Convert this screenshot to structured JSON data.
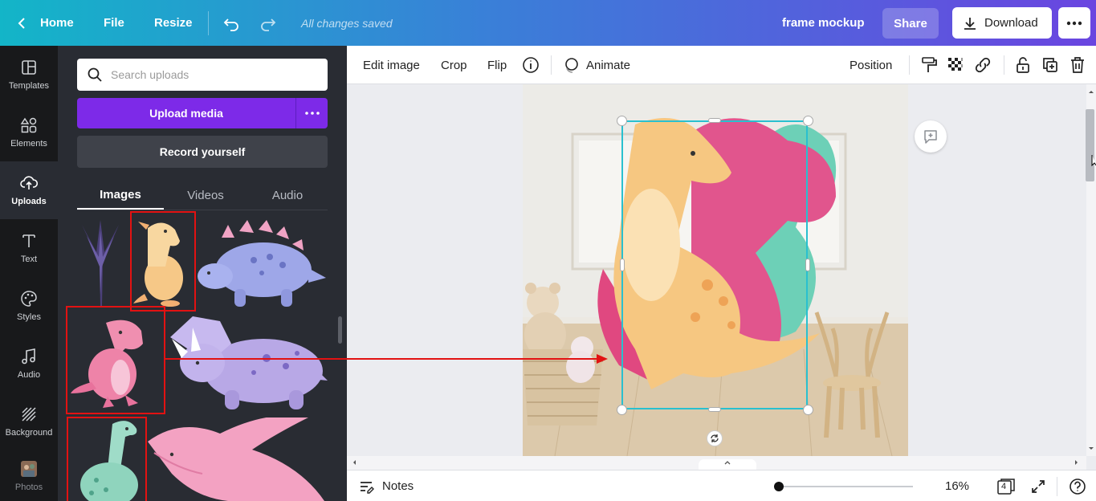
{
  "topbar": {
    "home": "Home",
    "file": "File",
    "resize": "Resize",
    "status": "All changes saved",
    "design_title": "frame mockup",
    "share": "Share",
    "download": "Download"
  },
  "rail": {
    "items": [
      {
        "label": "Templates",
        "icon": "templates-icon"
      },
      {
        "label": "Elements",
        "icon": "elements-icon"
      },
      {
        "label": "Uploads",
        "icon": "uploads-icon"
      },
      {
        "label": "Text",
        "icon": "text-icon"
      },
      {
        "label": "Styles",
        "icon": "palette-icon"
      },
      {
        "label": "Audio",
        "icon": "music-icon"
      },
      {
        "label": "Background",
        "icon": "background-icon"
      },
      {
        "label": "Photos",
        "icon": "photos-icon"
      }
    ]
  },
  "panel": {
    "search_placeholder": "Search uploads",
    "upload_label": "Upload media",
    "record_label": "Record yourself",
    "tabs": [
      "Images",
      "Videos",
      "Audio"
    ]
  },
  "toolbar": {
    "edit_image": "Edit image",
    "crop": "Crop",
    "flip": "Flip",
    "animate": "Animate",
    "position": "Position"
  },
  "bottom": {
    "notes": "Notes",
    "zoom": "16%",
    "page_count": "4"
  },
  "colors": {
    "accent": "#7d2ae8",
    "selection": "#29c0cf",
    "annotation": "#e21212"
  }
}
